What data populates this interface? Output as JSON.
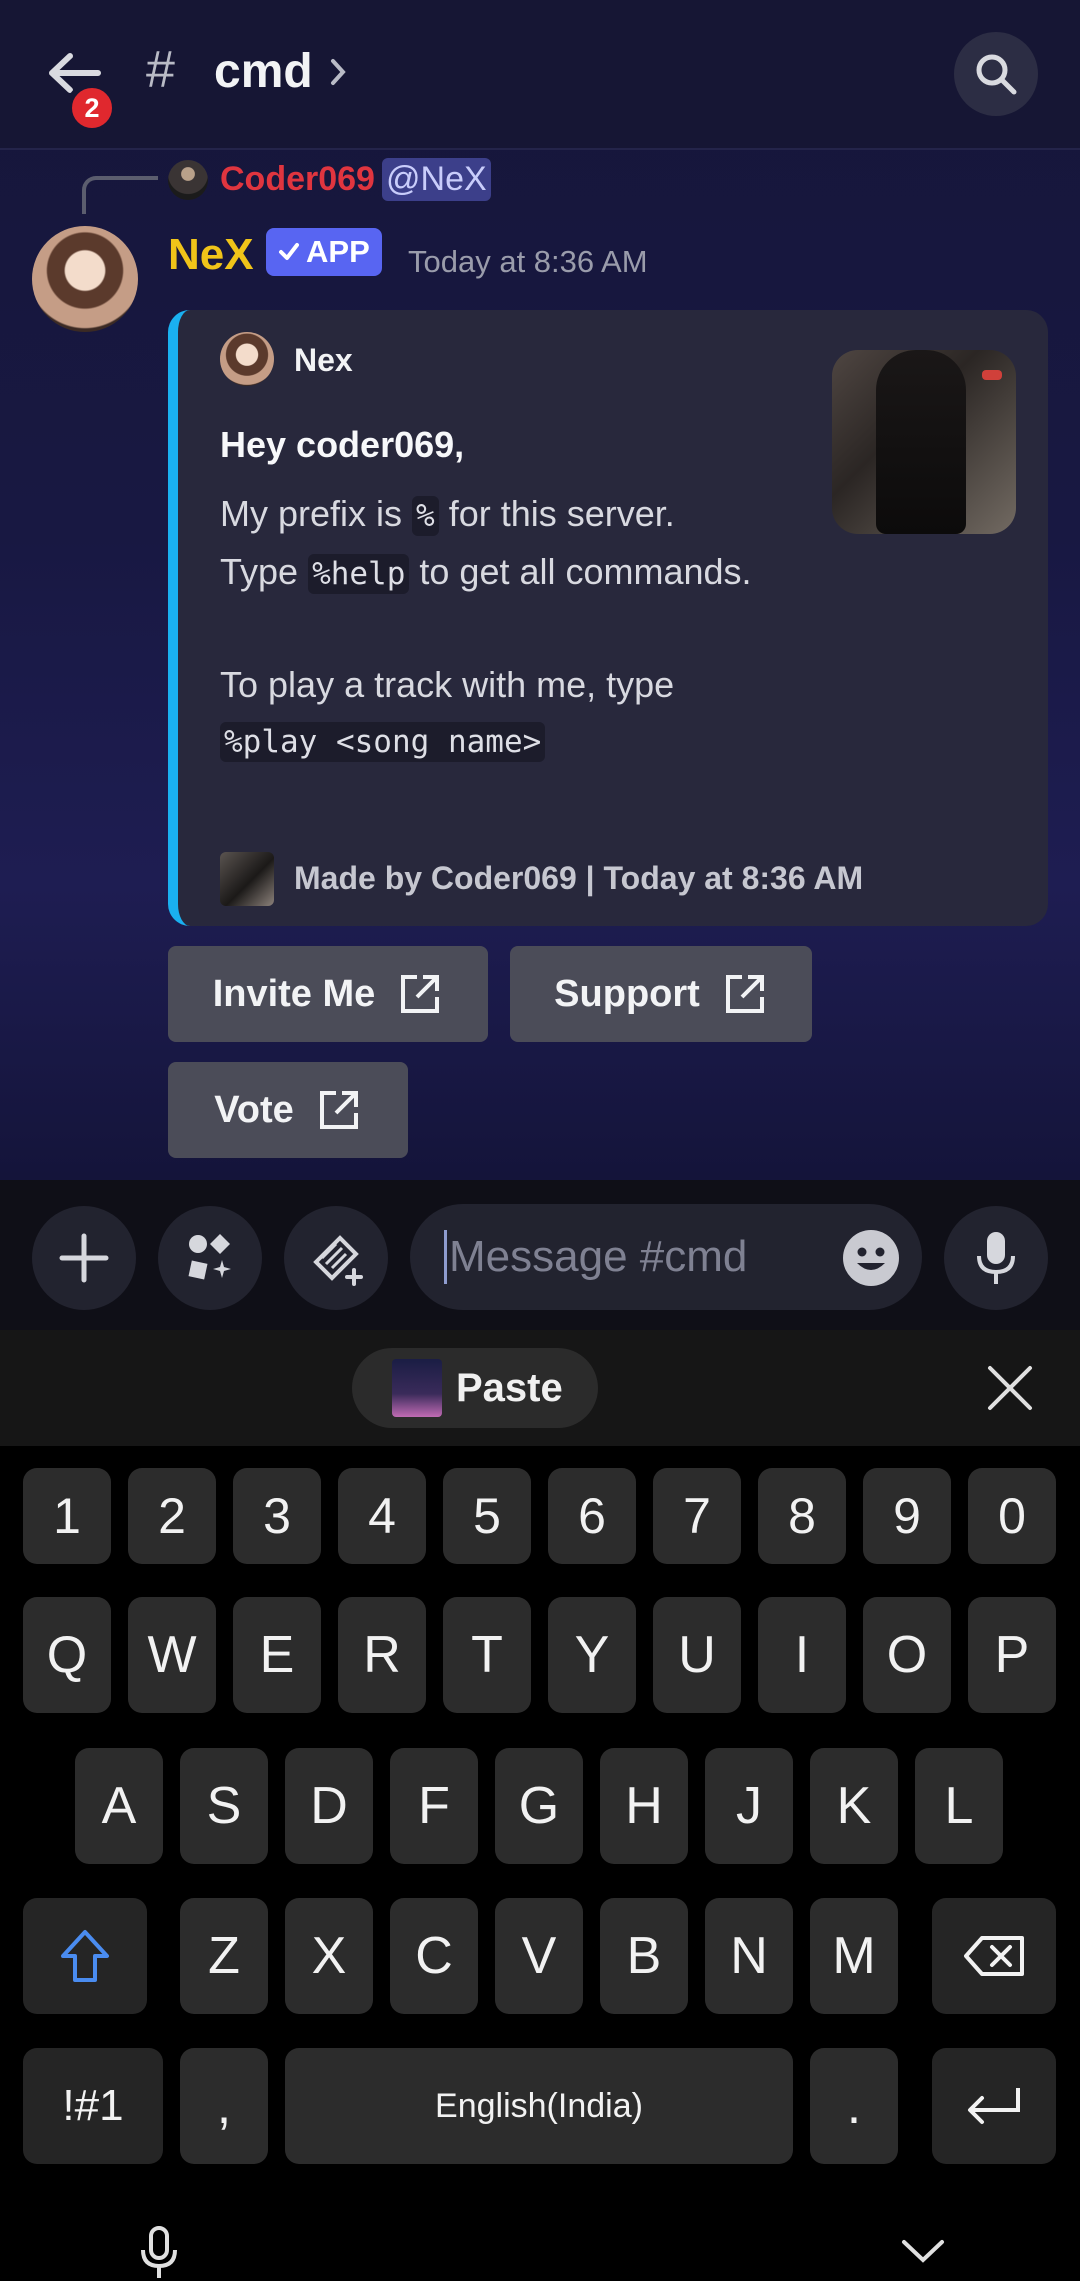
{
  "header": {
    "back_badge": "2",
    "channel_hash": "#",
    "channel_name": "cmd",
    "icons": [
      "back-arrow-icon",
      "chevron-right-icon",
      "search-icon"
    ]
  },
  "reply": {
    "author": "Coder069",
    "mention": "@NeX"
  },
  "message": {
    "author": "NeX",
    "app_tag": "APP",
    "timestamp": "Today at 8:36 AM",
    "embed": {
      "author": "Nex",
      "title": "Hey coder069,",
      "desc_1_pre": "My prefix is ",
      "desc_1_code": "%",
      "desc_1_post": " for this server.",
      "desc_2_pre": "Type ",
      "desc_2_code": "%help",
      "desc_2_post": " to get all commands.",
      "desc_3": "To play a track with me, type",
      "desc_3_code": "%play <song name>",
      "footer": "Made by Coder069 | Today at 8:36 AM",
      "accent_color": "#1ab0f0"
    },
    "buttons": {
      "invite": "Invite Me",
      "support": "Support",
      "vote": "Vote"
    }
  },
  "input": {
    "placeholder": "Message #cmd"
  },
  "clipboard": {
    "paste_label": "Paste"
  },
  "keyboard": {
    "numbers": [
      "1",
      "2",
      "3",
      "4",
      "5",
      "6",
      "7",
      "8",
      "9",
      "0"
    ],
    "row1": [
      "Q",
      "W",
      "E",
      "R",
      "T",
      "Y",
      "U",
      "I",
      "O",
      "P"
    ],
    "row2": [
      "A",
      "S",
      "D",
      "F",
      "G",
      "H",
      "J",
      "K",
      "L"
    ],
    "row3": [
      "Z",
      "X",
      "C",
      "V",
      "B",
      "N",
      "M"
    ],
    "symbols_label": "!#1",
    "comma": ",",
    "space_label": "English(India)",
    "period": "."
  },
  "colors": {
    "accent_blue": "#5865f2",
    "author_gold": "#f0c419",
    "reply_red": "#e0353f",
    "badge_red": "#e0282e"
  }
}
